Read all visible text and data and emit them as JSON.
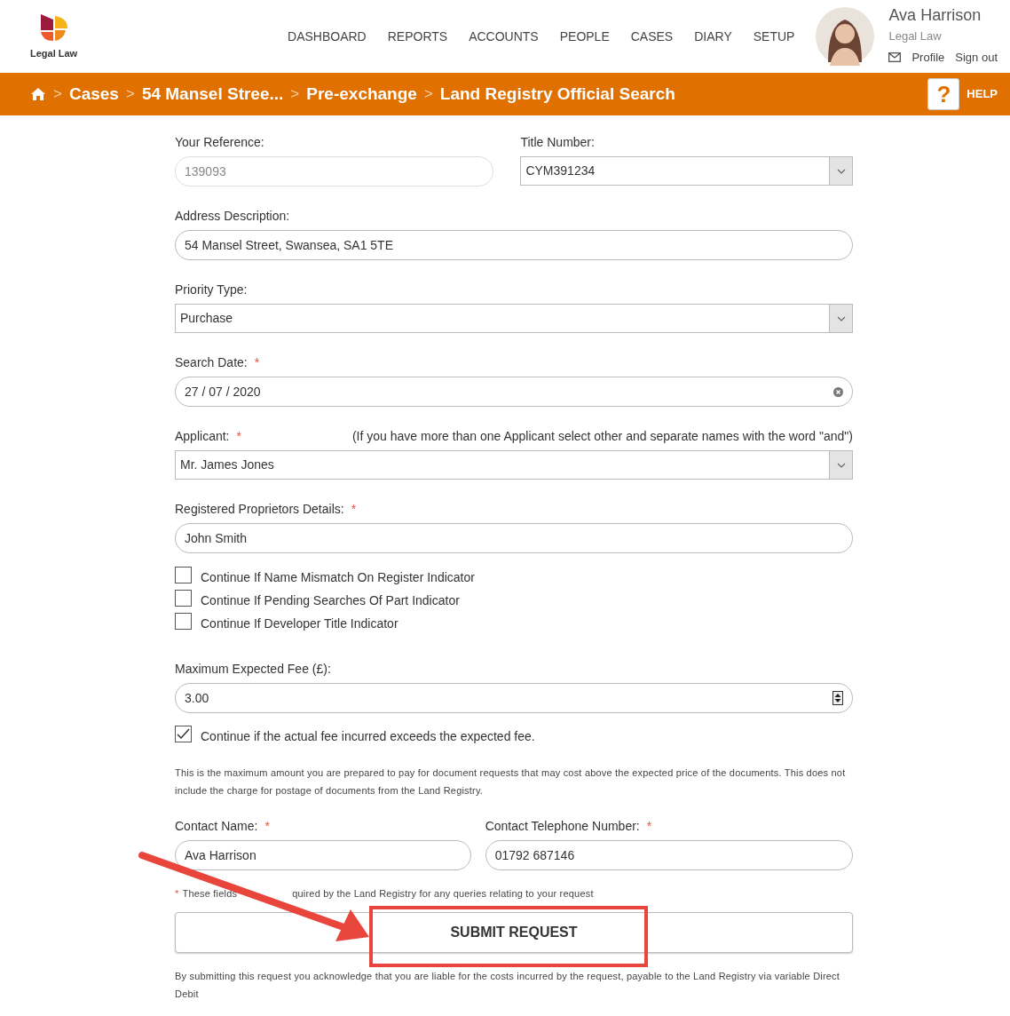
{
  "header": {
    "logo_text": "Legal Law",
    "nav": [
      "DASHBOARD",
      "REPORTS",
      "ACCOUNTS",
      "PEOPLE",
      "CASES",
      "DIARY",
      "SETUP"
    ],
    "user": {
      "name": "Ava Harrison",
      "org": "Legal Law",
      "links": [
        "Profile",
        "Sign out"
      ]
    }
  },
  "breadcrumb": {
    "separator": ">",
    "items": [
      "Cases",
      "54 Mansel Stree...",
      "Pre-exchange",
      "Land Registry Official Search"
    ],
    "help_icon": "?",
    "help": "HELP"
  },
  "form": {
    "rows": [
      [
        {
          "kind": "text",
          "label": "Your Reference:",
          "value": "139093",
          "disabled": true
        },
        {
          "kind": "select",
          "label": "Title Number:",
          "value": "CYM391234",
          "disabled": false
        }
      ],
      [
        {
          "kind": "text",
          "label": "Address Description:",
          "value": "54 Mansel Street, Swansea, SA1 5TE",
          "disabled": false
        }
      ],
      [
        {
          "kind": "select",
          "label": "Priority Type:",
          "value": "Purchase",
          "disabled": false
        }
      ],
      [
        {
          "kind": "date",
          "label": "Search Date:",
          "required_mark": "*",
          "value": "27 / 07 / 2020",
          "disabled": false
        }
      ],
      [
        {
          "kind": "select",
          "label": "Applicant:",
          "required_mark": "*",
          "hint": "(If you have more than one Applicant select other and separate names with the word \"and\")",
          "value": "Mr. James Jones",
          "disabled": false
        }
      ],
      [
        {
          "kind": "text",
          "label": "Registered Proprietors Details:",
          "required_mark": "*",
          "value": "John Smith",
          "disabled": false
        }
      ]
    ],
    "checkboxes": [
      {
        "label": "Continue If Name Mismatch On Register Indicator",
        "checked": false
      },
      {
        "label": "Continue If Pending Searches Of Part Indicator",
        "checked": false
      },
      {
        "label": "Continue If Developer Title Indicator",
        "checked": false
      }
    ],
    "fee": {
      "label": "Maximum Expected Fee (£):",
      "value": "3.00"
    },
    "fee_checkbox": {
      "label": "Continue if the actual fee incurred exceeds the expected fee.",
      "checked": true
    },
    "fee_note": "This is the maximum amount you are prepared to pay for document requests that may cost above the expected price of the documents. This does not include the charge for postage of documents from the Land Registry.",
    "contacts": [
      {
        "label": "Contact Name:",
        "required_mark": "*",
        "value": "Ava Harrison"
      },
      {
        "label": "Contact Telephone Number:",
        "required_mark": "*",
        "value": "01792 687146"
      }
    ],
    "required_note": {
      "mark": "*",
      "parts": [
        "These fields",
        "quired by the Land Registry for any queries relating to your request"
      ]
    },
    "submit": "SUBMIT REQUEST",
    "disclaimer": "By submitting this request you acknowledge that you are liable for the costs incurred by the request, payable to the Land Registry via variable Direct Debit"
  }
}
